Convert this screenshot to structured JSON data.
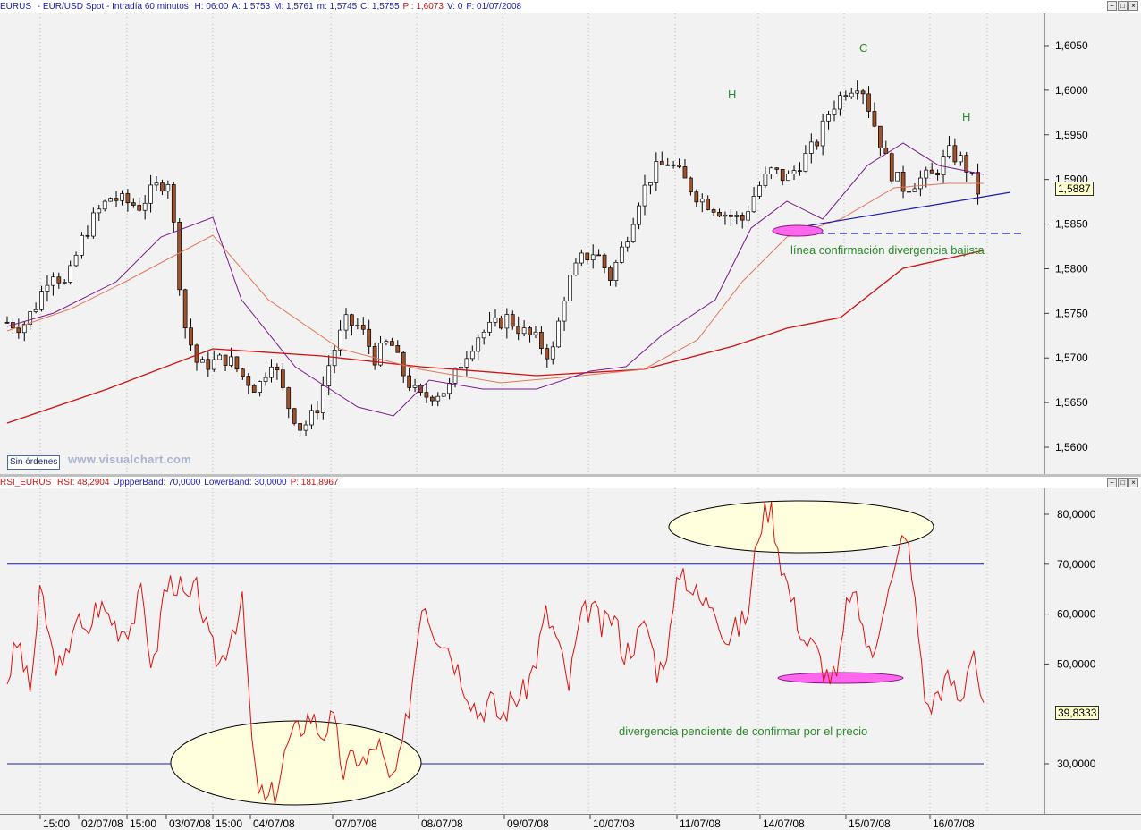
{
  "price_pane": {
    "header": {
      "symbol": "EURUS",
      "description": "- EUR/USD Spot - Intradía 60 minutos",
      "fields": [
        {
          "label": "H:",
          "value": "06:00"
        },
        {
          "label": "A:",
          "value": "1,5753"
        },
        {
          "label": "M:",
          "value": "1,5761"
        },
        {
          "label": "m:",
          "value": "1,5745"
        },
        {
          "label": "C:",
          "value": "1,5755"
        },
        {
          "label": "P :",
          "value": "1,6073"
        },
        {
          "label": "V:",
          "value": "0"
        },
        {
          "label": "F:",
          "value": "01/07/2008"
        }
      ]
    },
    "y_ticks": [
      "1,6050",
      "1,6000",
      "1,5950",
      "1,5900",
      "1,5850",
      "1,5800",
      "1,5750",
      "1,5700",
      "1,5650",
      "1,5600"
    ],
    "last_price": "1,5887",
    "annotations": {
      "h_left": "H",
      "c": "C",
      "h_right": "H",
      "confirm_line": "línea confirmación divergencia bajista"
    },
    "orders_button": "Sin órdenes",
    "watermark": "www.visualchart.com"
  },
  "rsi_pane": {
    "header": {
      "name": "RSI_EURUS",
      "fields": [
        {
          "label": "RSI:",
          "value": "48,2904",
          "color": "#d01010"
        },
        {
          "label": "UppperBand:",
          "value": "70,0000",
          "color": "#1a1ab0"
        },
        {
          "label": "LowerBand:",
          "value": "30,0000",
          "color": "#1a1ab0"
        },
        {
          "label": "P:",
          "value": "181,8967",
          "color": "#d01010"
        }
      ]
    },
    "y_ticks": [
      "80,0000",
      "70,0000",
      "60,0000",
      "50,0000",
      "30,0000"
    ],
    "last_value": "39,8333",
    "annotations": {
      "divergence_note": "divergencia pendiente de confirmar por el precio"
    }
  },
  "x_axis": {
    "labels": [
      "15:00",
      "02/07/08",
      "15:00",
      "03/07/08",
      "15:00",
      "04/07/08",
      "07/07/08",
      "08/07/08",
      "09/07/08",
      "10/07/08",
      "11/07/08",
      "14/07/08",
      "15/07/08",
      "16/07/08"
    ]
  },
  "colors": {
    "candle_up": "#ffffff",
    "candle_down": "#a0522d",
    "sma_fast": "#7a1a8c",
    "sma_mid": "#e0785a",
    "sma_slow": "#d01010",
    "rsi_line": "#e01010",
    "bands": "#1a1ab0",
    "annotation_text": "#2a8a2a",
    "highlight_ellipse": "#ffffdd",
    "divergence_ellipse": "#ff66ee"
  },
  "chart_data": [
    {
      "type": "candlestick",
      "title": "EURUS - EUR/USD Spot - Intradía 60 minutos",
      "ylim": [
        1.5585,
        1.6065
      ],
      "x": [
        "15:00",
        "02/07/08",
        "15:00",
        "03/07/08",
        "15:00",
        "04/07/08",
        "07/07/08",
        "08/07/08",
        "09/07/08",
        "10/07/08",
        "11/07/08",
        "14/07/08",
        "15/07/08",
        "16/07/08"
      ],
      "close": [
        1.574,
        1.5735,
        1.576,
        1.58,
        1.578,
        1.583,
        1.586,
        1.588,
        1.5875,
        1.587,
        1.589,
        1.59,
        1.574,
        1.569,
        1.5695,
        1.57,
        1.568,
        1.5665,
        1.57,
        1.565,
        1.562,
        1.564,
        1.57,
        1.574,
        1.5735,
        1.57,
        1.572,
        1.568,
        1.5655,
        1.566,
        1.5665,
        1.57,
        1.5725,
        1.5735,
        1.5745,
        1.573,
        1.572,
        1.57,
        1.578,
        1.581,
        1.582,
        1.579,
        1.583,
        1.588,
        1.591,
        1.592,
        1.59,
        1.588,
        1.587,
        1.586,
        1.5855,
        1.589,
        1.591,
        1.59,
        1.592,
        1.594,
        1.598,
        1.6,
        1.601,
        1.596,
        1.591,
        1.589,
        1.59,
        1.5905,
        1.593,
        1.592,
        1.5887
      ],
      "series": [
        {
          "name": "RSI_EURUS",
          "values": []
        }
      ]
    },
    {
      "type": "line",
      "title": "RSI_EURUS",
      "ylim": [
        20,
        85
      ],
      "series": [
        {
          "name": "RSI",
          "values": [
            47,
            55,
            44,
            65,
            52,
            48,
            60,
            55,
            62,
            60,
            57,
            58,
            64,
            48,
            65,
            67,
            62,
            65,
            54,
            50,
            57,
            62,
            28,
            22,
            25,
            34,
            37,
            40,
            36,
            39,
            28,
            32,
            30,
            35,
            26,
            30,
            45,
            64,
            57,
            55,
            50,
            45,
            40,
            43,
            39,
            43,
            44,
            50,
            60,
            55,
            45,
            58,
            62,
            57,
            60,
            52,
            55,
            58,
            48,
            55,
            70,
            65,
            62,
            63,
            55,
            57,
            60,
            78,
            82,
            70,
            62,
            55,
            53,
            48,
            47,
            65,
            60,
            50,
            62,
            67,
            78,
            60,
            40,
            45,
            47,
            42,
            55,
            40
          ],
          "color": "#e01010"
        },
        {
          "name": "UppperBand",
          "values": [
            70
          ]
        },
        {
          "name": "LowerBand",
          "values": [
            30
          ]
        }
      ]
    }
  ]
}
